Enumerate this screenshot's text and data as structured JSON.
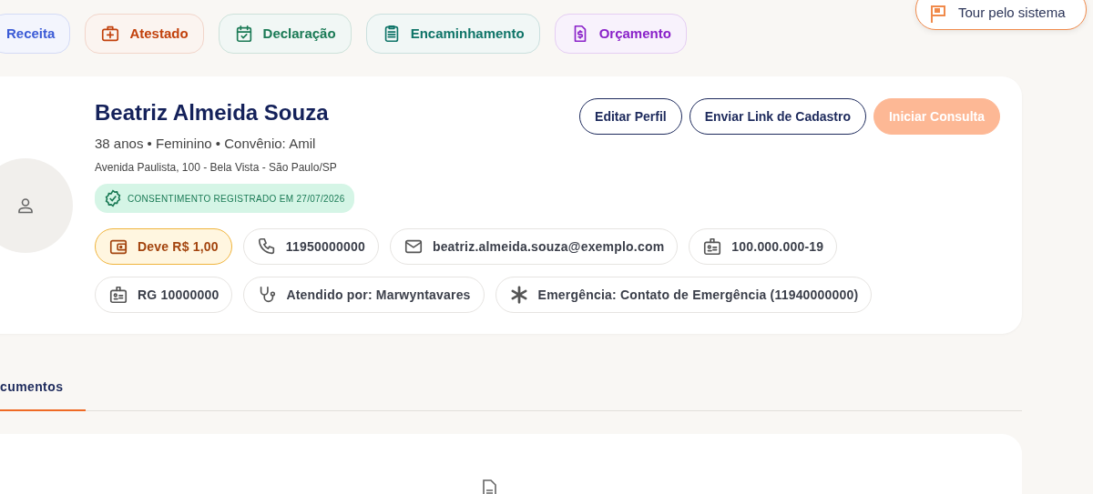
{
  "quick_actions": [
    {
      "label": "Receita",
      "color": "#3b5bd6",
      "kind": "none"
    },
    {
      "label": "Atestado",
      "color": "#c2410c",
      "kind": "medkit"
    },
    {
      "label": "Declaração",
      "color": "#1a7a55",
      "kind": "calendar"
    },
    {
      "label": "Encaminhamento",
      "color": "#0f7468",
      "kind": "clipboard"
    },
    {
      "label": "Orçamento",
      "color": "#8a22c9",
      "kind": "invoice"
    }
  ],
  "tour_button": {
    "label": "Tour pelo sistema"
  },
  "patient": {
    "name": "Beatriz Almeida Souza",
    "summary": "38 anos • Feminino • Convênio: Amil",
    "address": "Avenida Paulista, 100 - Bela Vista - São Paulo/SP",
    "consent": "CONSENTIMENTO REGISTRADO EM 27/07/2026",
    "buttons": [
      {
        "label": "Editar Perfil",
        "disabled": false,
        "kind": "outline"
      },
      {
        "label": "Enviar Link de Cadastro",
        "disabled": false,
        "kind": "outline"
      },
      {
        "label": "Iniciar Consulta",
        "disabled": true,
        "kind": "primary"
      }
    ],
    "chips": [
      {
        "kind": "debt",
        "label": "Deve R$ 1,00"
      },
      {
        "kind": "phone",
        "label": "11950000000"
      },
      {
        "kind": "email",
        "label": "beatriz.almeida.souza@exemplo.com"
      },
      {
        "kind": "document",
        "label": "100.000.000-19"
      },
      {
        "kind": "document",
        "label": "RG 10000000"
      },
      {
        "kind": "attendant",
        "label": "Atendido por: Marwyntavares"
      },
      {
        "kind": "emergency",
        "label": "Emergência: Contato de Emergência (11940000000)"
      }
    ]
  },
  "tabs": [
    {
      "label": "cumentos",
      "selected": true
    }
  ]
}
